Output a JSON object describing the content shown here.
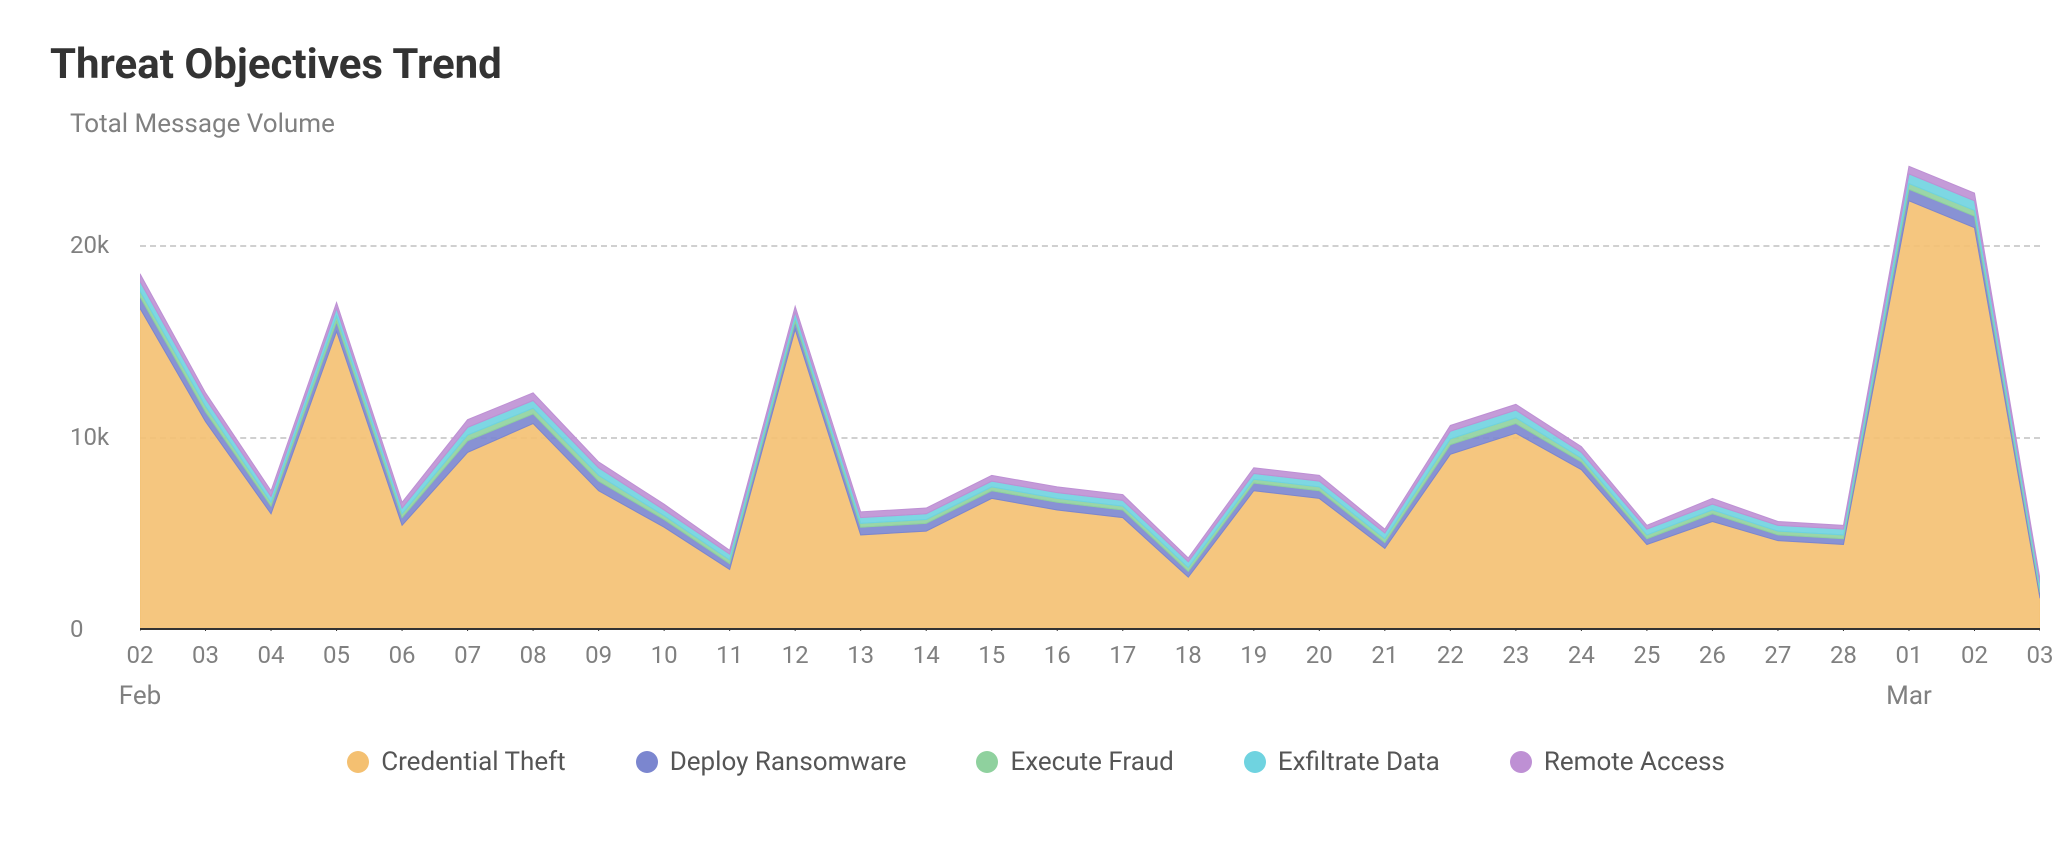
{
  "title": "Threat Objectives Trend",
  "ylabel": "Total Message Volume",
  "chart_data": {
    "type": "area",
    "xlabel": "",
    "ylabel": "Total Message Volume",
    "title": "Threat Objectives Trend",
    "ylim": [
      0,
      25000
    ],
    "yticks": [
      0,
      10000,
      20000
    ],
    "ytick_labels": [
      "0",
      "10k",
      "20k"
    ],
    "categories": [
      "02",
      "03",
      "04",
      "05",
      "06",
      "07",
      "08",
      "09",
      "10",
      "11",
      "12",
      "13",
      "14",
      "15",
      "16",
      "17",
      "18",
      "19",
      "20",
      "21",
      "22",
      "23",
      "24",
      "25",
      "26",
      "27",
      "28",
      "01",
      "02",
      "03"
    ],
    "month_markers": [
      {
        "index": 0,
        "label": "Feb"
      },
      {
        "index": 27,
        "label": "Mar"
      }
    ],
    "series": [
      {
        "name": "Credential Theft",
        "color": "#F4C071",
        "values": [
          16700,
          10800,
          6000,
          15500,
          5400,
          9200,
          10700,
          7200,
          5300,
          3100,
          15600,
          4900,
          5100,
          6800,
          6200,
          5800,
          2700,
          7200,
          6800,
          4200,
          9100,
          10200,
          8300,
          4400,
          5600,
          4600,
          4400,
          22300,
          20900,
          1600
        ]
      },
      {
        "name": "Deploy Ransomware",
        "color": "#7B86CF",
        "values": [
          600,
          500,
          400,
          500,
          400,
          600,
          500,
          500,
          400,
          300,
          400,
          400,
          400,
          400,
          400,
          400,
          300,
          400,
          400,
          300,
          500,
          500,
          400,
          300,
          400,
          300,
          300,
          600,
          600,
          300
        ]
      },
      {
        "name": "Execute Fraud",
        "color": "#8FD19E",
        "values": [
          300,
          300,
          200,
          300,
          200,
          300,
          300,
          300,
          200,
          200,
          200,
          200,
          200,
          200,
          200,
          200,
          200,
          200,
          200,
          200,
          300,
          300,
          200,
          200,
          200,
          200,
          200,
          300,
          300,
          200
        ]
      },
      {
        "name": "Exfiltrate Data",
        "color": "#6FD3E0",
        "values": [
          500,
          400,
          300,
          400,
          300,
          400,
          400,
          400,
          300,
          300,
          300,
          300,
          300,
          300,
          300,
          300,
          300,
          300,
          300,
          300,
          400,
          400,
          300,
          300,
          300,
          300,
          300,
          500,
          500,
          300
        ]
      },
      {
        "name": "Remote Access",
        "color": "#BE90D4",
        "values": [
          400,
          300,
          300,
          300,
          300,
          400,
          400,
          300,
          300,
          200,
          300,
          300,
          300,
          300,
          300,
          300,
          200,
          300,
          300,
          200,
          300,
          300,
          300,
          200,
          300,
          200,
          200,
          400,
          400,
          200
        ]
      }
    ],
    "legend_position": "bottom"
  }
}
